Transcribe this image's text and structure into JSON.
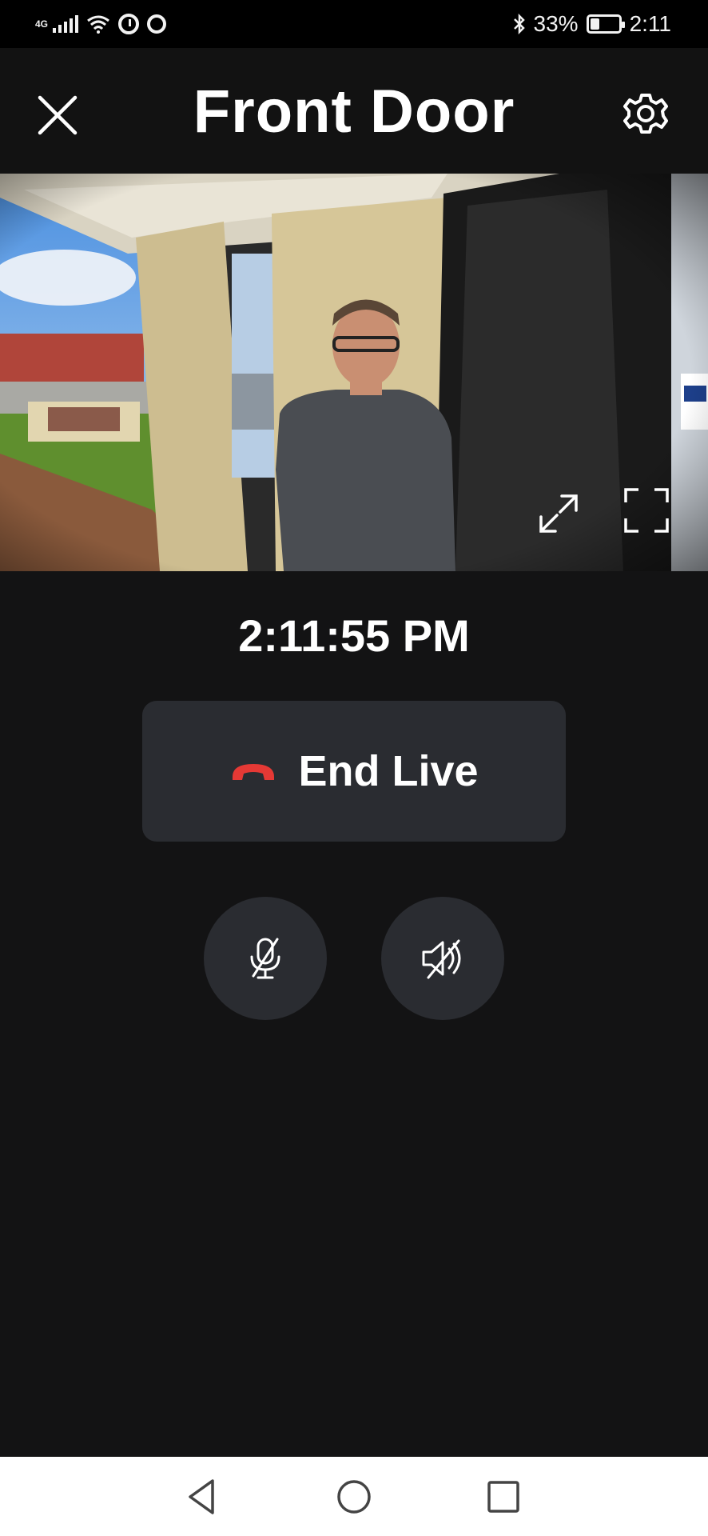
{
  "status_bar": {
    "network": "4G",
    "battery": "33%",
    "battery_level": 0.33,
    "time": "2:11",
    "icons": [
      "signal-icon",
      "wifi-icon",
      "alarm-icon",
      "sync-icon",
      "bluetooth-icon",
      "battery-icon"
    ]
  },
  "header": {
    "title": "Front Door",
    "close_icon": "close-icon",
    "settings_icon": "gear-icon"
  },
  "video": {
    "expand_icon": "expand-icon",
    "fullscreen_icon": "fullscreen-icon"
  },
  "timestamp": "2:11:55 PM",
  "end_live": {
    "label": "End Live",
    "icon": "hang-up-icon",
    "icon_color": "#e53935"
  },
  "controls": {
    "mic_icon": "mic-muted-icon",
    "speaker_icon": "speaker-muted-icon"
  },
  "nav_bar": {
    "back_icon": "back-icon",
    "home_icon": "home-icon",
    "recents_icon": "recents-icon"
  },
  "colors": {
    "background": "#131314",
    "button": "#2a2c31",
    "accent_red": "#e53935"
  }
}
